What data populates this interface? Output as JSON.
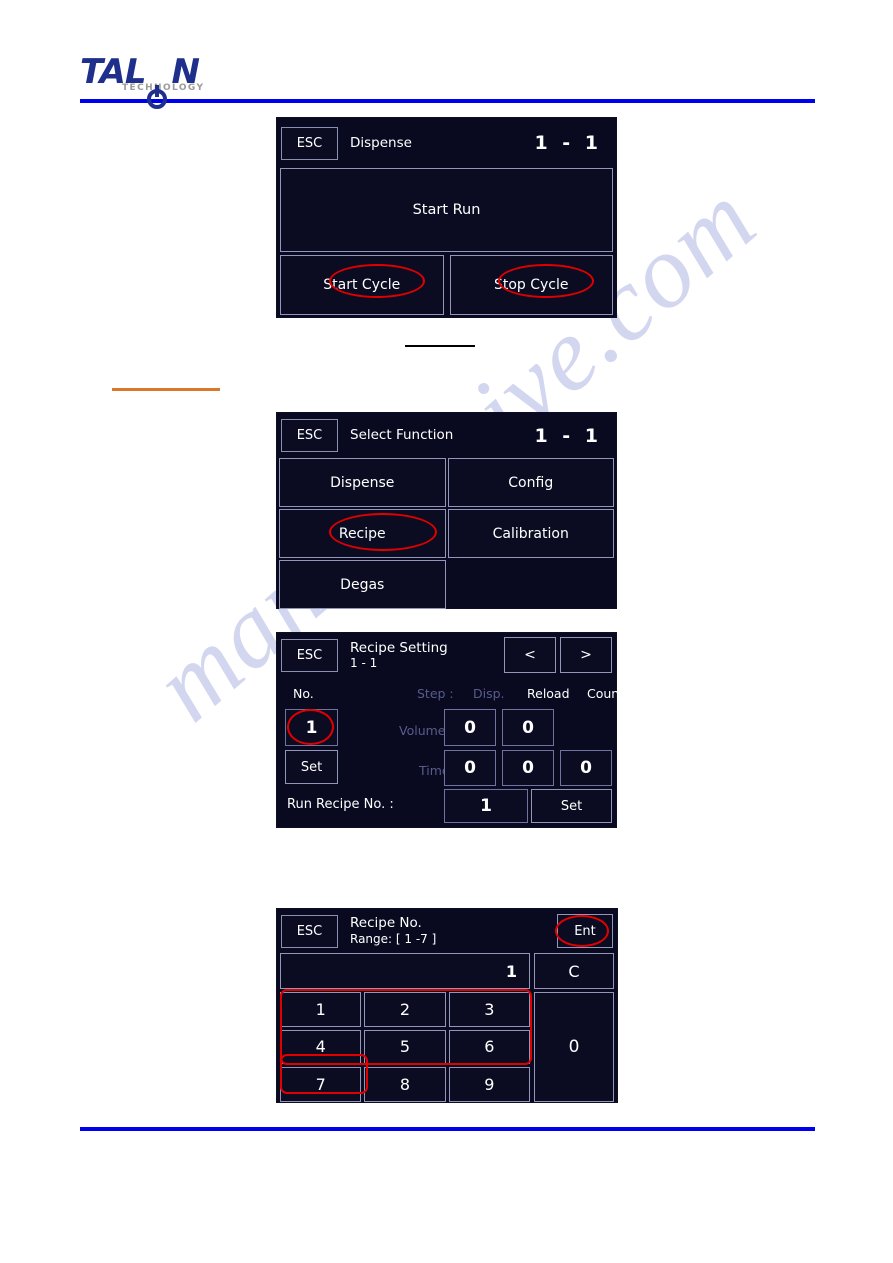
{
  "logo": {
    "word_part1": "TAL",
    "word_part2": "N",
    "subtitle": "TECHNOLOGY"
  },
  "watermark": {
    "text": "manualshive.com"
  },
  "screens": [
    {
      "id": "dispense",
      "esc_label": "ESC",
      "title": "Dispense",
      "page": "1  -  1",
      "run_label": "Start Run",
      "start_cycle_label": "Start Cycle",
      "stop_cycle_label": "Stop Cycle"
    },
    {
      "id": "select-function",
      "esc_label": "ESC",
      "title": "Select Function",
      "page": "1  -  1",
      "buttons": [
        "Dispense",
        "Config",
        "Recipe",
        "Calibration",
        "Degas"
      ]
    },
    {
      "id": "recipe-setting",
      "esc_label": "ESC",
      "title": "Recipe Setting",
      "subtitle": "1 - 1",
      "page": "",
      "prev_label": "<",
      "next_label": ">",
      "col_no": "No.",
      "col_step": "Step :",
      "col_disp": "Disp.",
      "col_reload": "Reload",
      "col_count": "Count",
      "row_volume": "Volume :",
      "row_time": "Time :",
      "recipe_no_value": "1",
      "set_label": "Set",
      "volume_disp": "0",
      "volume_reload": "0",
      "time_disp": "0",
      "time_reload": "0",
      "time_count": "0",
      "run_recipe_label": "Run Recipe No. :",
      "run_recipe_value": "1",
      "run_recipe_set": "Set"
    },
    {
      "id": "recipe-keypad",
      "esc_label": "ESC",
      "title": "Recipe No.",
      "subtitle": "Range: [ 1 -7 ]",
      "ent_label": "Ent",
      "display_value": "1",
      "clear_label": "C",
      "keys": [
        "1",
        "2",
        "3",
        "4",
        "5",
        "6",
        "7",
        "8",
        "9"
      ],
      "zero_label": "0"
    }
  ],
  "colors": {
    "screen_bg": "#090a20",
    "cell_border": "#9296bb",
    "annotation_red": "#e00000",
    "rule_blue": "#0000f0",
    "rule_orange": "#d9772b",
    "logo_blue": "#1f2f8c"
  }
}
